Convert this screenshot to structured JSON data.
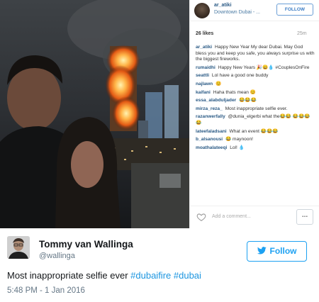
{
  "instagram": {
    "username": "ar_atiki",
    "location": "Downtown Dubai - ...",
    "follow_label": "FOLLOW",
    "likes": "26 likes",
    "time_ago": "25m",
    "caption_user": "ar_atiki",
    "caption_text": "Happy New Year My dear Dubai. May God bless you and keep you safe, you always surprise us with the biggest fireworks.",
    "comments": [
      {
        "user": "rumaidhi",
        "text": "Happy New Years 🎉😀💧 #CouplesOnFire"
      },
      {
        "user": "seattli",
        "text": "Lol have a good one buddy"
      },
      {
        "user": "najlawn",
        "text": "😊"
      },
      {
        "user": "kaifani",
        "text": "Haha thats mean 😊"
      },
      {
        "user": "essa_alabduljader",
        "text": "😂😂😂"
      },
      {
        "user": "mirza_reza_",
        "text": "Most inappropriate selfie ever."
      },
      {
        "user": "razanwerfally",
        "text": "@dunia_elgerbi what the😂😂 😂😂😂😂"
      },
      {
        "user": "lateefaladsani",
        "text": "What an event 😂😂😂"
      },
      {
        "user": "b_alsanousi",
        "text": "😂 maynoon!"
      },
      {
        "user": "moathalateeqi",
        "text": "Lol! 💧"
      }
    ],
    "add_comment_placeholder": "Add a comment...",
    "more_label": "..."
  },
  "tweet": {
    "name": "Tommy van Wallinga",
    "handle": "@wallinga",
    "follow_label": "Follow",
    "text_plain": "Most inappropriate selfie ever ",
    "hashtag_1": "#dubaifire",
    "hashtag_2": "#dubai",
    "timestamp": "5:48 PM - 1 Jan 2016"
  },
  "colors": {
    "twitter_blue": "#1da1f2",
    "hashtag_blue": "#1b95e0",
    "ig_link": "#2a5a85"
  }
}
